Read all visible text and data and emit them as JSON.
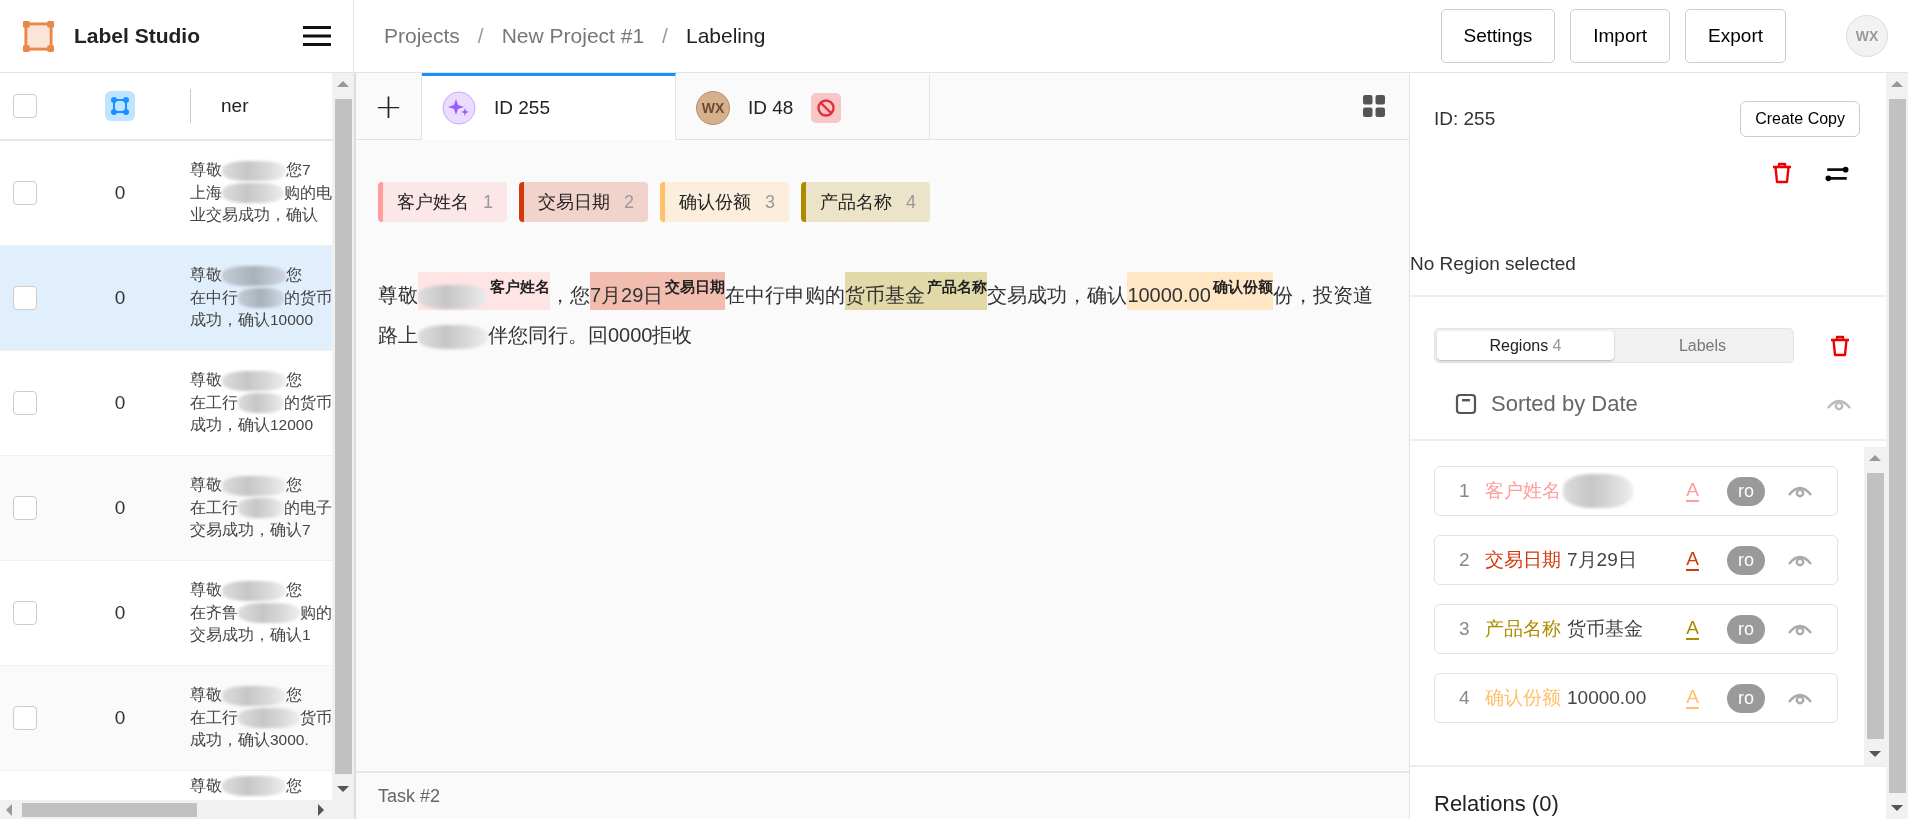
{
  "header": {
    "app_name": "Label Studio",
    "breadcrumbs": [
      "Projects",
      "New Project #1",
      "Labeling"
    ],
    "separator": "/",
    "buttons": [
      "Settings",
      "Import",
      "Export"
    ],
    "avatar": "WX"
  },
  "task_list": {
    "column": "ner",
    "header_checked": false,
    "rows": [
      {
        "selected": false,
        "checked": false,
        "count": "0",
        "lines": [
          [
            "尊敬",
            "您7"
          ],
          [
            "上海",
            "购的电"
          ],
          [
            "业交易成功，确认"
          ]
        ]
      },
      {
        "selected": true,
        "checked": false,
        "count": "0",
        "lines": [
          [
            "尊敬",
            "您"
          ],
          [
            "在中行",
            "的货币"
          ],
          [
            "成功，确认10000"
          ]
        ]
      },
      {
        "selected": false,
        "checked": false,
        "count": "0",
        "lines": [
          [
            "尊敬",
            "您"
          ],
          [
            "在工行",
            "的货币"
          ],
          [
            "成功，确认12000"
          ]
        ]
      },
      {
        "selected": false,
        "checked": false,
        "count": "0",
        "lines": [
          [
            "尊敬",
            "您"
          ],
          [
            "在工行",
            "的电子"
          ],
          [
            "交易成功，确认7"
          ]
        ]
      },
      {
        "selected": false,
        "checked": false,
        "count": "0",
        "lines": [
          [
            "尊敬",
            "您"
          ],
          [
            "在齐鲁",
            "购的"
          ],
          [
            "交易成功，确认1"
          ]
        ]
      },
      {
        "selected": false,
        "checked": false,
        "count": "0",
        "lines": [
          [
            "尊敬",
            "您"
          ],
          [
            "在工行",
            "货币"
          ],
          [
            "成功，确认3000."
          ]
        ]
      },
      {
        "selected": false,
        "lines": [
          [
            "尊敬",
            "您"
          ]
        ]
      }
    ]
  },
  "add_tab": "+",
  "tabs": [
    {
      "label": "ID 255",
      "selected": true,
      "kind": "sparkle",
      "skipped": false
    },
    {
      "label": "ID 48",
      "selected": false,
      "kind": "initials",
      "avatar": "WX",
      "skipped": true
    }
  ],
  "labels": [
    {
      "name": "客户姓名",
      "hotkey": "1",
      "color": "#ff9c9c"
    },
    {
      "name": "交易日期",
      "hotkey": "2",
      "color": "#d4380d"
    },
    {
      "name": "确认份额",
      "hotkey": "3",
      "color": "#ffc069"
    },
    {
      "name": "产品名称",
      "hotkey": "4",
      "color": "#ad8b00"
    }
  ],
  "text": [
    {
      "kind": "text",
      "text": "尊敬"
    },
    {
      "kind": "entity",
      "label": "客户姓名",
      "color": "#ffe4e4",
      "redacted": true
    },
    {
      "kind": "text",
      "text": "，您"
    },
    {
      "kind": "entity",
      "text": "7月29日",
      "label": "交易日期",
      "color": "#f2bcae",
      "redacted": false
    },
    {
      "kind": "text",
      "text": "在中行申购的"
    },
    {
      "kind": "entity",
      "text": "货币基金",
      "label": "产品名称",
      "color": "#e2d9a8",
      "redacted": false
    },
    {
      "kind": "text",
      "text": "交易成功，确认"
    },
    {
      "kind": "entity",
      "text": "10000.00",
      "label": "确认份额",
      "color": "#ffe7c6",
      "redacted": false
    },
    {
      "kind": "text",
      "text": "份，投资道路上"
    },
    {
      "kind": "redacted"
    },
    {
      "kind": "text",
      "text": "伴您同行。回0000拒收"
    }
  ],
  "footer": {
    "task": "Task #2"
  },
  "sidebar": {
    "id": "ID: 255",
    "create_copy": "Create Copy",
    "no_selection": "No Region selected",
    "tabs": [
      {
        "label": "Regions",
        "count": "4",
        "selected": true
      },
      {
        "label": "Labels",
        "selected": false
      }
    ],
    "sort": "Sorted by Date",
    "regions": [
      {
        "index": "1",
        "label": "客户姓名",
        "color": "#ff9c9c",
        "redacted": true,
        "icon_letter": "A",
        "badge": "ro"
      },
      {
        "index": "2",
        "label": "交易日期",
        "text": "7月29日",
        "color": "#d4380d",
        "redacted": false,
        "icon_letter": "A",
        "badge": "ro"
      },
      {
        "index": "3",
        "label": "产品名称",
        "text": "货币基金",
        "color": "#ad8b00",
        "redacted": false,
        "icon_letter": "A",
        "badge": "ro"
      },
      {
        "index": "4",
        "label": "确认份额",
        "text": "10000.00",
        "color": "#ffc069",
        "redacted": false,
        "icon_letter": "A",
        "badge": "ro"
      }
    ],
    "relations": "Relations (0)"
  }
}
